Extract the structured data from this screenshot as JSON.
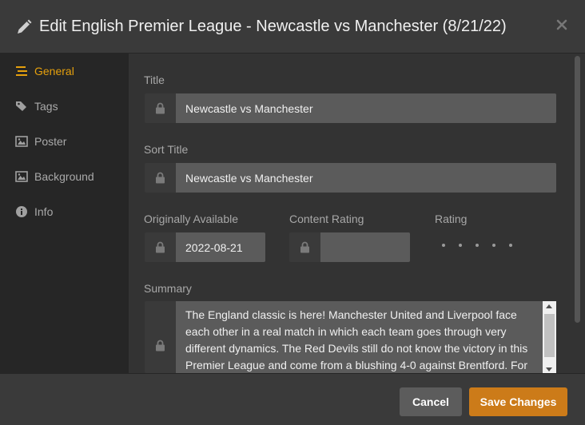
{
  "dialog": {
    "title": "Edit English Premier League - Newcastle vs Manchester (8/21/22)"
  },
  "sidebar": {
    "items": [
      {
        "label": "General",
        "icon": "list-icon",
        "active": true
      },
      {
        "label": "Tags",
        "icon": "tag-icon"
      },
      {
        "label": "Poster",
        "icon": "image-icon"
      },
      {
        "label": "Background",
        "icon": "image-icon"
      },
      {
        "label": "Info",
        "icon": "info-icon"
      }
    ]
  },
  "form": {
    "title_label": "Title",
    "title_value": "Newcastle vs Manchester",
    "sort_title_label": "Sort Title",
    "sort_title_value": "Newcastle vs Manchester",
    "originally_available_label": "Originally Available",
    "originally_available_value": "2022-08-21",
    "content_rating_label": "Content Rating",
    "content_rating_value": "",
    "rating_label": "Rating",
    "rating_value": 0,
    "rating_max": 5,
    "summary_label": "Summary",
    "summary_lines": [
      "The England classic is here! Manchester United and Liverpool face",
      "each other in a real match in which each team goes through very",
      "different dynamics. The Red Devils still do not know the victory in this",
      "Premier League and come from a blushing 4-0 against Brentford. For"
    ]
  },
  "footer": {
    "cancel_label": "Cancel",
    "save_label": "Save Changes"
  },
  "colors": {
    "accent": "#e5a00d",
    "save_button": "#cc7b19",
    "cancel_button": "#5c5c5c"
  }
}
